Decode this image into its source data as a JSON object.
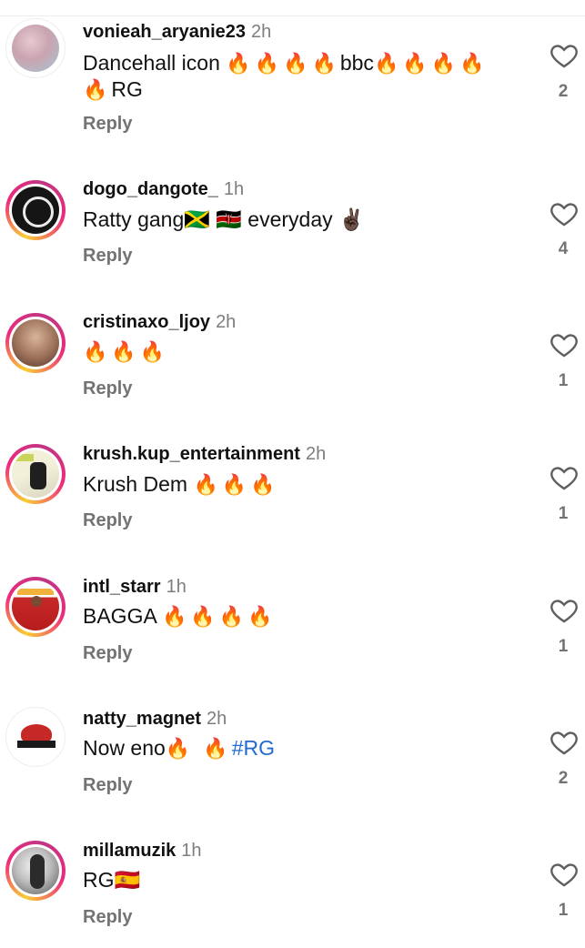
{
  "comments": [
    {
      "username": "vonieah_aryanie23",
      "time": "2h",
      "text_a": "Dancehall icon ",
      "fire_a": "🔥🔥🔥🔥",
      "text_b": "bbc",
      "fire_b": "🔥🔥🔥🔥🔥",
      "text_c": "RG",
      "reply": "Reply",
      "likes": "2",
      "avatar_colors": [
        "#d9b8c2",
        "#a7c7d6"
      ]
    },
    {
      "username": "dogo_dangote_",
      "time": "1h",
      "text_a": "Ratty gang",
      "flags": "🇯🇲 🇰🇪",
      "text_b": " everyday ",
      "emoji": "✌🏿",
      "reply": "Reply",
      "likes": "4",
      "avatar_colors": [
        "#151515",
        "#e8e8e8"
      ]
    },
    {
      "username": "cristinaxo_ljoy",
      "time": "2h",
      "fire_a": "🔥🔥🔥",
      "reply": "Reply",
      "likes": "1",
      "avatar_colors": [
        "#6b4b3e",
        "#d4b69e"
      ]
    },
    {
      "username": "krush.kup_entertainment",
      "time": "2h",
      "text_a": "Krush Dem ",
      "fire_a": "🔥🔥🔥",
      "reply": "Reply",
      "likes": "1",
      "avatar_colors": [
        "#f2f0d9",
        "#d43a3a"
      ]
    },
    {
      "username": "intl_starr",
      "time": "1h",
      "text_a": "BAGGA ",
      "fire_a": "🔥🔥🔥🔥",
      "reply": "Reply",
      "likes": "1",
      "avatar_colors": [
        "#c62828",
        "#ffffff"
      ]
    },
    {
      "username": "natty_magnet",
      "time": "2h",
      "text_a": "Now eno",
      "fire_a": "🔥 🔥",
      "hashtag": "#RG",
      "reply": "Reply",
      "likes": "2",
      "avatar_colors": [
        "#ffffff",
        "#c62828"
      ]
    },
    {
      "username": "millamuzik",
      "time": "1h",
      "text_a": "RG",
      "flags": "🇪🇸",
      "reply": "Reply",
      "likes": "1",
      "avatar_colors": [
        "#dedede",
        "#555555"
      ]
    }
  ]
}
